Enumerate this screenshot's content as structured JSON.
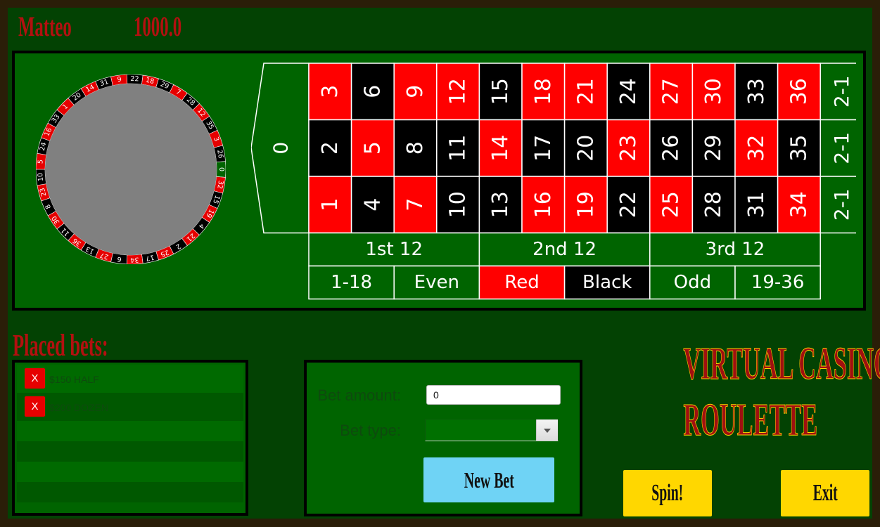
{
  "player": {
    "name": "Matteo",
    "balance": "1000.0"
  },
  "wheel": {
    "sequence": [
      "0",
      "32",
      "15",
      "19",
      "4",
      "21",
      "2",
      "25",
      "17",
      "34",
      "6",
      "27",
      "13",
      "36",
      "11",
      "30",
      "8",
      "23",
      "10",
      "5",
      "24",
      "16",
      "33",
      "1",
      "20",
      "14",
      "31",
      "9",
      "22",
      "18",
      "29",
      "7",
      "28",
      "12",
      "35",
      "3",
      "26"
    ],
    "colors": {
      "red": "#e60000",
      "black": "#000000",
      "green": "#006400",
      "hub": "#808080"
    }
  },
  "board": {
    "zero": "0",
    "columns": [
      [
        "3",
        "2",
        "1"
      ],
      [
        "6",
        "5",
        "4"
      ],
      [
        "9",
        "8",
        "7"
      ],
      [
        "12",
        "11",
        "10"
      ],
      [
        "15",
        "14",
        "13"
      ],
      [
        "18",
        "17",
        "16"
      ],
      [
        "21",
        "20",
        "19"
      ],
      [
        "24",
        "23",
        "22"
      ],
      [
        "27",
        "26",
        "25"
      ],
      [
        "30",
        "29",
        "28"
      ],
      [
        "33",
        "32",
        "31"
      ],
      [
        "36",
        "35",
        "34"
      ]
    ],
    "red_numbers": [
      "1",
      "3",
      "5",
      "7",
      "9",
      "12",
      "14",
      "16",
      "18",
      "19",
      "21",
      "23",
      "25",
      "27",
      "30",
      "32",
      "34",
      "36"
    ],
    "column_bets": [
      "2-1",
      "2-1",
      "2-1"
    ],
    "dozens": [
      "1st 12",
      "2nd 12",
      "3rd 12"
    ],
    "outside": [
      {
        "label": "1-18",
        "color": "#006400"
      },
      {
        "label": "Even",
        "color": "#006400"
      },
      {
        "label": "Red",
        "color": "#ff0000"
      },
      {
        "label": "Black",
        "color": "#000000"
      },
      {
        "label": "Odd",
        "color": "#006400"
      },
      {
        "label": "19-36",
        "color": "#006400"
      }
    ]
  },
  "placed_bets": {
    "title": "Placed bets:",
    "items": [
      {
        "remove_label": "X",
        "label": "$150 HALF"
      },
      {
        "remove_label": "X",
        "label": "$200 DOZEN"
      }
    ]
  },
  "form": {
    "amount_label": "Bet amount:",
    "amount_value": "0",
    "type_label": "Bet type:",
    "type_value": "",
    "new_bet_label": "New Bet"
  },
  "game_title": {
    "line1": "VIRTUAL CASINO -",
    "line2": "ROULETTE"
  },
  "actions": {
    "spin": "Spin!",
    "exit": "Exit"
  }
}
